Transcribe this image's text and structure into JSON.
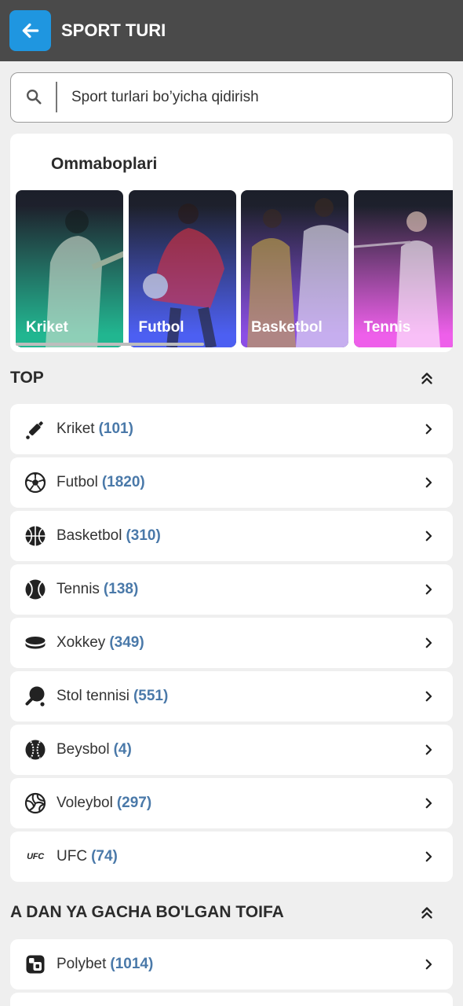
{
  "header": {
    "title": "SPORT TURI",
    "back_icon": "arrow-left-icon"
  },
  "search": {
    "placeholder": "Sport turlari bo’yicha qidirish",
    "icon": "search-icon"
  },
  "popular": {
    "title": "Ommaboplari",
    "tiles": [
      {
        "label": "Kriket",
        "color": "#21b690"
      },
      {
        "label": "Futbol",
        "color": "#4c5ff2"
      },
      {
        "label": "Basketbol",
        "color": "#8b4ee6"
      },
      {
        "label": "Tennis",
        "color": "#ee5fea"
      }
    ]
  },
  "top": {
    "title": "TOP",
    "collapse_icon": "double-chevron-up-icon",
    "items": [
      {
        "name": "Kriket",
        "count": "(101)",
        "icon": "cricket-icon"
      },
      {
        "name": "Futbol",
        "count": "(1820)",
        "icon": "soccer-ball-icon"
      },
      {
        "name": "Basketbol",
        "count": "(310)",
        "icon": "basketball-icon"
      },
      {
        "name": "Tennis",
        "count": "(138)",
        "icon": "tennis-ball-icon"
      },
      {
        "name": "Xokkey",
        "count": "(349)",
        "icon": "hockey-puck-icon"
      },
      {
        "name": "Stol tennisi",
        "count": "(551)",
        "icon": "table-tennis-icon"
      },
      {
        "name": "Beysbol",
        "count": "(4)",
        "icon": "baseball-icon"
      },
      {
        "name": "Voleybol",
        "count": "(297)",
        "icon": "volleyball-icon"
      },
      {
        "name": "UFC",
        "count": "(74)",
        "icon": "ufc-logo-icon",
        "icon_text": "UFC"
      }
    ]
  },
  "az": {
    "title": "A DAN YA GACHA BO'LGAN TOIFA",
    "collapse_icon": "double-chevron-up-icon",
    "items": [
      {
        "name": "Polybet",
        "count": "(1014)",
        "icon": "polybet-icon"
      }
    ]
  },
  "colors": {
    "header_bg": "#4a4a4a",
    "accent": "#1f96e0",
    "page_bg": "#efefef",
    "count": "#4a79a9"
  }
}
